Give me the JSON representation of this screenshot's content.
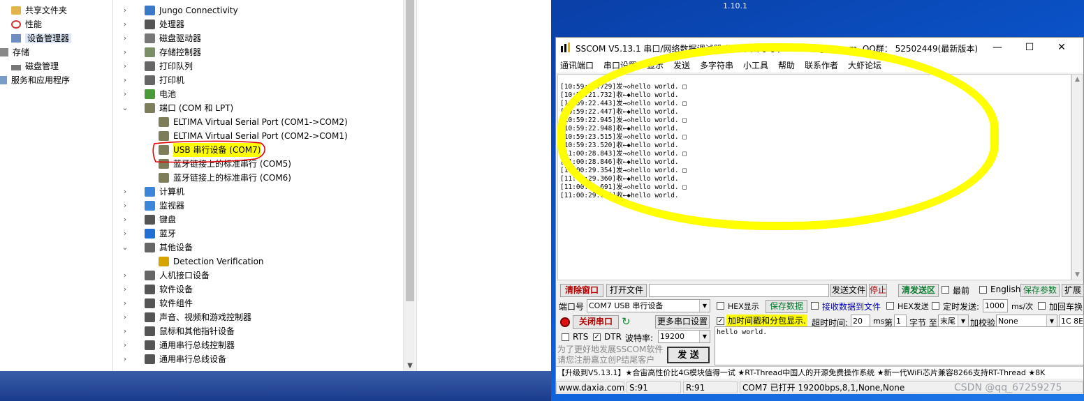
{
  "left_tree": [
    {
      "label": "共享文件夹",
      "icon": "shared-folder-icon"
    },
    {
      "label": "性能",
      "icon": "performance-icon"
    },
    {
      "label": "设备管理器",
      "icon": "device-manager-icon"
    },
    {
      "label": "存储",
      "icon": "storage-icon"
    },
    {
      "label": "磁盘管理",
      "icon": "disk-management-icon"
    },
    {
      "label": "服务和应用程序",
      "icon": "services-icon"
    }
  ],
  "device_tree": [
    {
      "label": "Jungo Connectivity",
      "icon": "jungo-icon"
    },
    {
      "label": "处理器",
      "icon": "processor-icon"
    },
    {
      "label": "磁盘驱动器",
      "icon": "disk-drive-icon"
    },
    {
      "label": "存储控制器",
      "icon": "storage-controller-icon"
    },
    {
      "label": "打印队列",
      "icon": "print-queue-icon"
    },
    {
      "label": "打印机",
      "icon": "printer-icon"
    },
    {
      "label": "电池",
      "icon": "battery-icon"
    },
    {
      "label": "端口 (COM 和 LPT)",
      "icon": "port-icon"
    },
    {
      "label": "ELTIMA Virtual Serial Port (COM1->COM2)",
      "icon": "port-icon"
    },
    {
      "label": "ELTIMA Virtual Serial Port (COM2->COM1)",
      "icon": "port-icon"
    },
    {
      "label": "USB 串行设备 (COM7)",
      "icon": "port-icon"
    },
    {
      "label": "蓝牙链接上的标准串行 (COM5)",
      "icon": "port-icon"
    },
    {
      "label": "蓝牙链接上的标准串行 (COM6)",
      "icon": "port-icon"
    },
    {
      "label": "计算机",
      "icon": "computer-icon"
    },
    {
      "label": "监视器",
      "icon": "monitor-icon"
    },
    {
      "label": "键盘",
      "icon": "keyboard-icon"
    },
    {
      "label": "蓝牙",
      "icon": "bluetooth-icon"
    },
    {
      "label": "其他设备",
      "icon": "other-devices-icon"
    },
    {
      "label": "Detection Verification",
      "icon": "warning-device-icon"
    },
    {
      "label": "人机接口设备",
      "icon": "hid-icon"
    },
    {
      "label": "软件设备",
      "icon": "software-device-icon"
    },
    {
      "label": "软件组件",
      "icon": "software-component-icon"
    },
    {
      "label": "声音、视频和游戏控制器",
      "icon": "sound-icon"
    },
    {
      "label": "鼠标和其他指针设备",
      "icon": "mouse-icon"
    },
    {
      "label": "通用串行总线控制器",
      "icon": "usb-icon"
    },
    {
      "label": "通用串行总线设备",
      "icon": "usb-icon"
    }
  ],
  "desktop": {
    "version_text": "1.10.1"
  },
  "sscom": {
    "title": "SSCOM V5.13.1 串口/网络数据调试器,作者:大虾丁丁,2618058@qq.com. QQ群： 52502449(最新版本)",
    "menu": [
      "通讯端口",
      "串口设置",
      "显示",
      "发送",
      "多字符串",
      "小工具",
      "帮助",
      "联系作者",
      "大虾论坛"
    ],
    "log": [
      "[10:59:21.729]发→◇hello world. □",
      "[10:59:21.732]收←◆hello world.",
      "[10:59:22.443]发→◇hello world. □",
      "[10:59:22.447]收←◆hello world.",
      "[10:59:22.945]发→◇hello world. □",
      "[10:59:22.948]收←◆hello world.",
      "[10:59:23.515]发→◇hello world. □",
      "[10:59:23.520]收←◆hello world.",
      "[11:00:28.843]发→◇hello world. □",
      "[11:00:28.846]收←◆hello world.",
      "[11:00:29.354]发→◇hello world. □",
      "[11:00:29.360]收←◆hello world.",
      "[11:00:29.691]发→◇hello world. □",
      "[11:00:29.694]收←◆hello world."
    ],
    "toolbar": {
      "clear": "清除窗口",
      "open_file": "打开文件",
      "send_file": "发送文件",
      "stop": "停止",
      "clear_send": "清发送区",
      "topmost": "最前",
      "english": "English",
      "save_params": "保存参数",
      "expand": "扩展"
    },
    "port": {
      "label": "端口号",
      "value": "COM7 USB 串行设备",
      "hex_display": "HEX显示",
      "save_data": "保存数据",
      "recv_to_file": "接收数据到文件",
      "hex_send": "HEX发送",
      "timed_send": "定时发送:",
      "interval": "1000",
      "interval_unit": "ms/次",
      "add_crlf": "加回车换"
    },
    "row2": {
      "close_port": "关闭串口",
      "more_settings": "更多串口设置",
      "timestamp": "加时间戳和分包显示.",
      "timeout_label": "超时时间:",
      "timeout": "20",
      "ms": "ms",
      "di": "第",
      "byte_from": "1",
      "byte_label": "字节 至",
      "tail": "末尾",
      "checksum_label": "加校验",
      "checksum": "None",
      "extra": "1C 8E"
    },
    "row3": {
      "rts": "RTS",
      "dtr": "DTR",
      "baud_label": "波特率:",
      "baud": "19200"
    },
    "promo": [
      "为了更好地发展SSCOM软件",
      "请您注册嘉立创P结尾客户"
    ],
    "send_btn": "发  送",
    "send_text": "hello world.",
    "ticker": "【升级到V5.13.1】★合宙高性价比4G模块值得一试 ★RT-Thread中国人的开源免费操作系统 ★新一代WiFi芯片兼容8266支持RT-Thread ★8K",
    "status": {
      "site": "www.daxia.com",
      "s": "S:91",
      "r": "R:91",
      "info": "COM7 已打开  19200bps,8,1,None,None"
    }
  },
  "watermark": "CSDN @qq_67259275",
  "colors": {
    "highlight_yellow": "#ffff00",
    "annotation_red": "#e00000",
    "desktop_blue": "#0b5bd6"
  }
}
